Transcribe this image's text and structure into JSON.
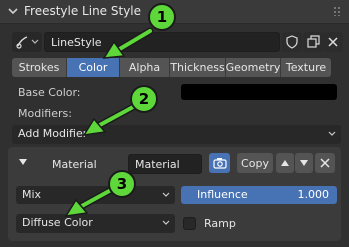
{
  "panel": {
    "title": "Freestyle Line Style"
  },
  "linestyle": {
    "name": "LineStyle"
  },
  "tabs": [
    {
      "label": "Strokes"
    },
    {
      "label": "Color"
    },
    {
      "label": "Alpha"
    },
    {
      "label": "Thickness"
    },
    {
      "label": "Geometry"
    },
    {
      "label": "Texture"
    }
  ],
  "base_color_label": "Base Color:",
  "base_color_value": "#000000",
  "modifiers_label": "Modifiers:",
  "add_modifier": "Add Modifier",
  "modifier": {
    "type_label": "Material",
    "name_value": "Material",
    "copy_label": "Copy",
    "blend": "Mix",
    "influence_label": "Influence",
    "influence_value": "1.000",
    "source": "Diffuse Color",
    "ramp_label": "Ramp"
  },
  "badges": [
    "1",
    "2",
    "3"
  ],
  "colors": {
    "accent": "#4772b3",
    "badge": "#5dd73a"
  }
}
